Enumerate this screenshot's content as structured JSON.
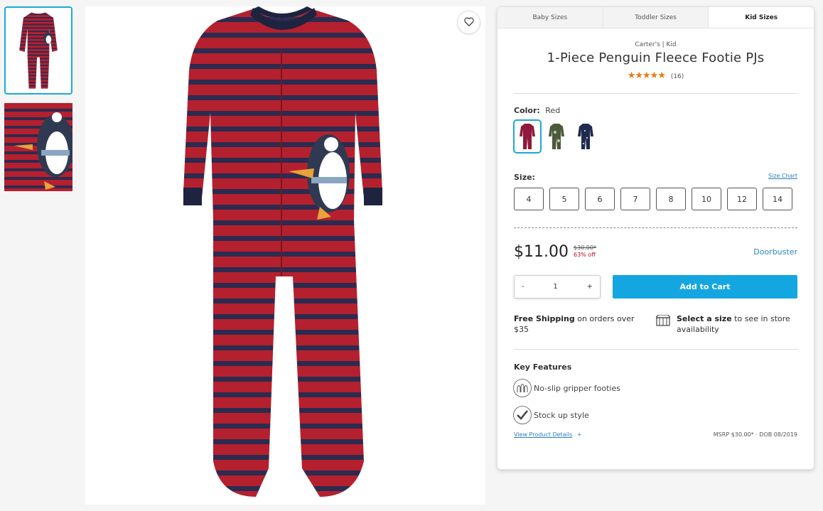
{
  "tabs": [
    "Baby Sizes",
    "Toddler Sizes",
    "Kid Sizes"
  ],
  "product": {
    "brand": "Carter's | Kid",
    "title": "1-Piece Penguin Fleece Footie PJs",
    "stars": "★★★★★",
    "rating_count": "(16)"
  },
  "color": {
    "label": "Color:",
    "value": "Red",
    "swatches": [
      "red-stripe",
      "camo-green",
      "navy-print"
    ]
  },
  "size": {
    "label": "Size:",
    "chart_link": "Size Chart",
    "options": [
      "4",
      "5",
      "6",
      "7",
      "8",
      "10",
      "12",
      "14"
    ]
  },
  "price": {
    "current": "$11.00",
    "original": "$30.00*",
    "discount": "63% off",
    "badge": "Doorbuster"
  },
  "cart": {
    "minus": "-",
    "quantity": "1",
    "plus": "+",
    "add_label": "Add to Cart"
  },
  "shipping": {
    "bold": "Free Shipping",
    "text": " on orders over $35"
  },
  "store": {
    "bold": "Select a size",
    "text": " to see in store availability"
  },
  "features": {
    "title": "Key Features",
    "items": [
      "No-slip gripper footies",
      "Stock up style"
    ]
  },
  "footer": {
    "details_link": "View Product Details",
    "details_plus": "+",
    "msrp": "MSRP $30.00* · DOB 08/2019"
  },
  "colors": {
    "accent": "#1aa9d9",
    "cart_button": "#14a6e0",
    "pj_red": "#b5202e",
    "pj_stripe": "#2d2b4f",
    "star": "#e87b10"
  }
}
